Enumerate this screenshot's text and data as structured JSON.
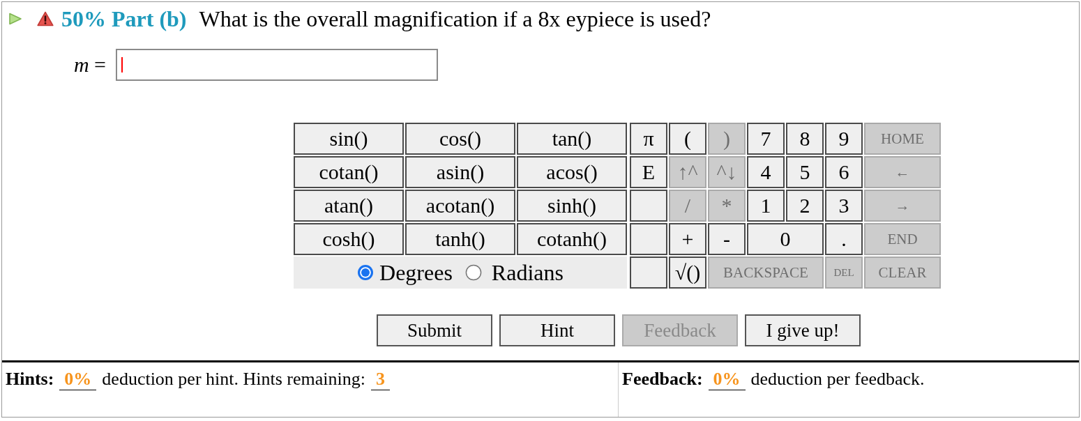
{
  "question": {
    "part_label": "50% Part (b)",
    "text": "What is the overall magnification if a 8x eypiece is used?"
  },
  "answer": {
    "label": "*m* =",
    "focused": true
  },
  "keypad": {
    "functions": [
      "sin()",
      "cos()",
      "tan()",
      "cotan()",
      "asin()",
      "acos()",
      "atan()",
      "acotan()",
      "sinh()",
      "cosh()",
      "tanh()",
      "cotanh()"
    ],
    "angle_modes": [
      {
        "label": "Degrees",
        "selected": true
      },
      {
        "label": "Radians",
        "selected": false
      }
    ],
    "keys": [
      {
        "label": "π",
        "kind": "single",
        "disabled": false
      },
      {
        "label": "(",
        "kind": "single",
        "disabled": false
      },
      {
        "label": ")",
        "kind": "single",
        "disabled": true
      },
      {
        "label": "7",
        "kind": "single",
        "disabled": false
      },
      {
        "label": "8",
        "kind": "single",
        "disabled": false
      },
      {
        "label": "9",
        "kind": "single",
        "disabled": false
      },
      {
        "label": "HOME",
        "kind": "double",
        "disabled": true
      },
      {
        "label": "E",
        "kind": "single",
        "disabled": false
      },
      {
        "label": "↑^",
        "kind": "single",
        "disabled": true
      },
      {
        "label": "^↓",
        "kind": "single",
        "disabled": true
      },
      {
        "label": "4",
        "kind": "single",
        "disabled": false
      },
      {
        "label": "5",
        "kind": "single",
        "disabled": false
      },
      {
        "label": "6",
        "kind": "single",
        "disabled": false
      },
      {
        "label": "←",
        "kind": "double",
        "disabled": true
      },
      {
        "kind": "blank",
        "disabled": false
      },
      {
        "label": "/",
        "kind": "single",
        "disabled": true
      },
      {
        "label": "*",
        "kind": "single",
        "disabled": true
      },
      {
        "label": "1",
        "kind": "single",
        "disabled": false
      },
      {
        "label": "2",
        "kind": "single",
        "disabled": false
      },
      {
        "label": "3",
        "kind": "single",
        "disabled": false
      },
      {
        "label": "→",
        "kind": "double",
        "disabled": true
      },
      {
        "kind": "blank",
        "disabled": false
      },
      {
        "label": "+",
        "kind": "single",
        "disabled": false
      },
      {
        "label": "-",
        "kind": "single",
        "disabled": false
      },
      {
        "label": "0",
        "kind": "double",
        "disabled": false
      },
      {
        "label": ".",
        "kind": "single",
        "disabled": false
      },
      {
        "label": "END",
        "kind": "double",
        "disabled": true
      },
      {
        "kind": "blank",
        "disabled": false
      },
      {
        "label": "√()",
        "kind": "single",
        "disabled": false
      },
      {
        "label": "BACKSPACE",
        "kind": "triple",
        "disabled": true
      },
      {
        "label": "DEL",
        "kind": "single",
        "disabled": true
      },
      {
        "label": "CLEAR",
        "kind": "double",
        "disabled": true
      }
    ]
  },
  "buttons": [
    {
      "label": "Submit",
      "disabled": false
    },
    {
      "label": "Hint",
      "disabled": false
    },
    {
      "label": "Feedback",
      "disabled": true
    },
    {
      "label": "I give up!",
      "disabled": false
    }
  ],
  "hints": {
    "label": "Hints:",
    "deduction": "0%",
    "text": "deduction per hint. Hints remaining:",
    "remaining": "3"
  },
  "feedback": {
    "label": "Feedback:",
    "deduction": "0%",
    "text": "deduction per feedback."
  }
}
